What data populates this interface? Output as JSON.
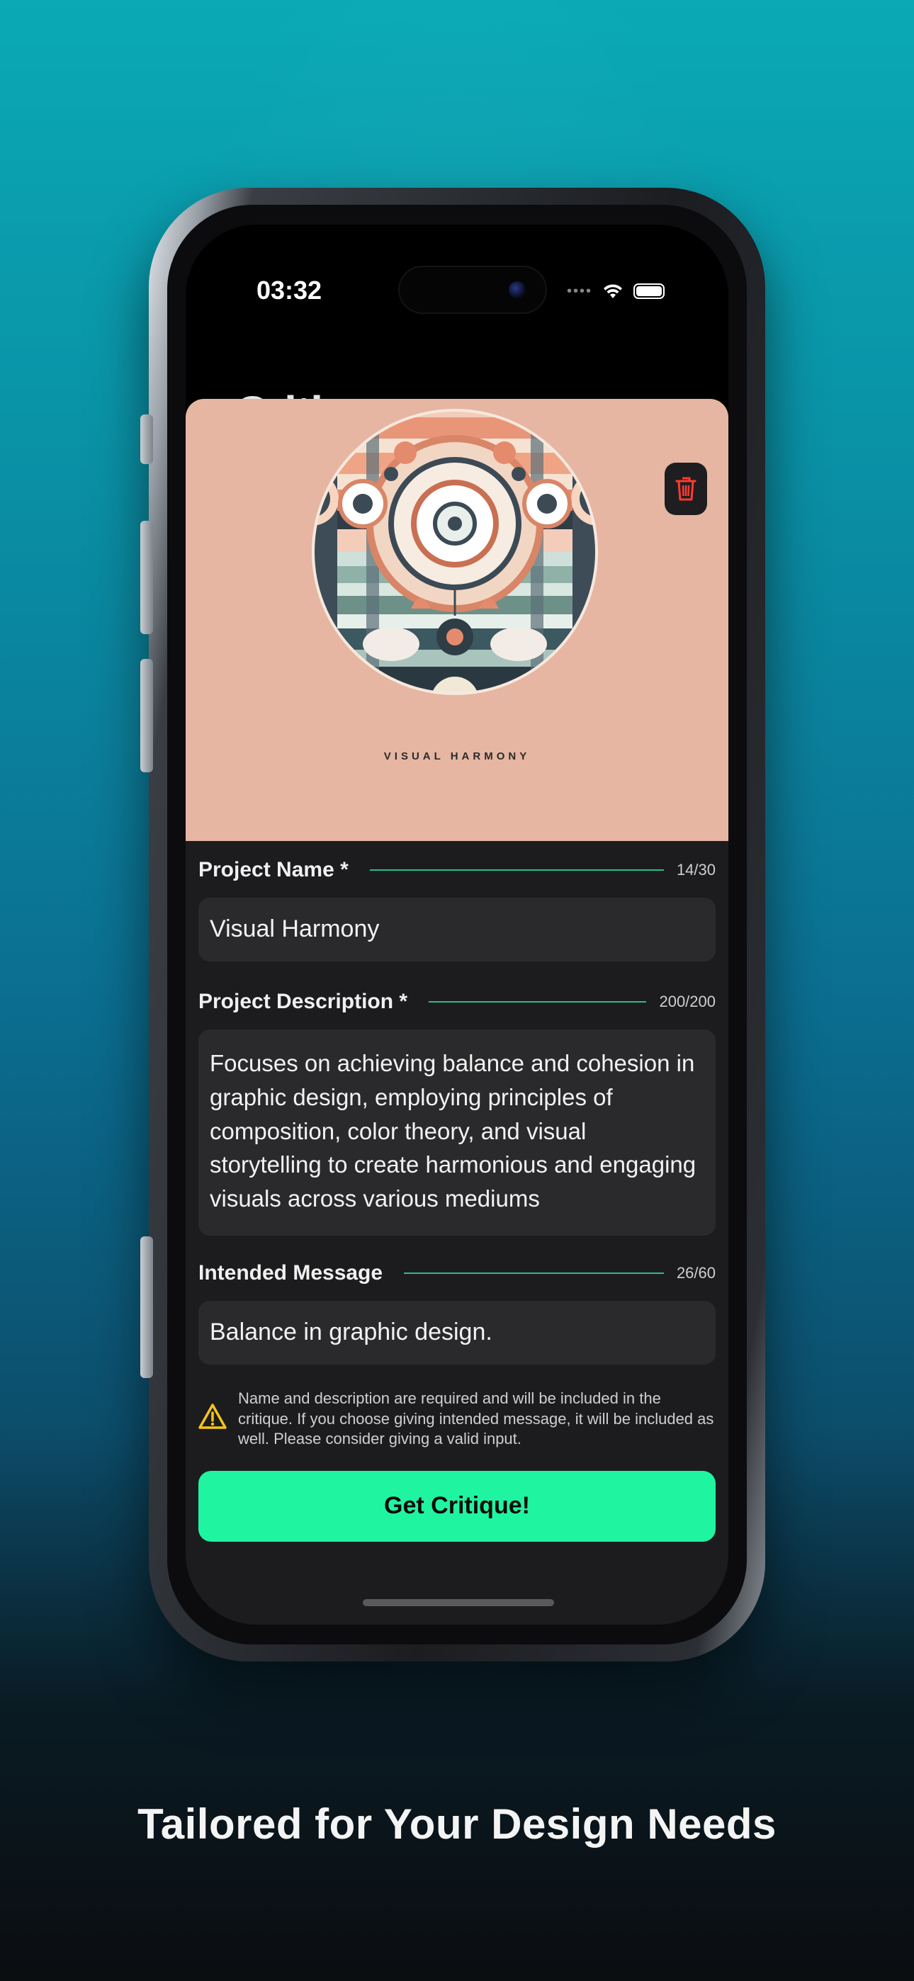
{
  "status": {
    "time": "03:32"
  },
  "background_screen": {
    "title": "Critiques"
  },
  "cover": {
    "caption": "VISUAL HARMONY"
  },
  "form": {
    "name": {
      "label": "Project Name *",
      "count": "14/30",
      "value": "Visual Harmony"
    },
    "description": {
      "label": "Project Description *",
      "count": "200/200",
      "value": "Focuses on achieving balance and cohesion in graphic design, employing principles of composition, color theory, and visual storytelling to create harmonious and engaging visuals across various mediums"
    },
    "message": {
      "label": "Intended Message",
      "count": "26/60",
      "value": "Balance in graphic design."
    },
    "notice": "Name and description are required and will be included in the critique. If you choose giving intended message, it will be included as well. Please consider giving a valid input.",
    "submit_label": "Get Critique!"
  },
  "headline": "Tailored for Your Design Needs",
  "colors": {
    "accent": "#1ff5a0",
    "cover_bg": "#e6b6a2",
    "delete_icon": "#ff3b30",
    "warning": "#f5c518",
    "progress_line": "#2fcf95"
  },
  "icons": [
    "trash-icon",
    "warning-icon",
    "wifi-icon",
    "battery-icon"
  ]
}
